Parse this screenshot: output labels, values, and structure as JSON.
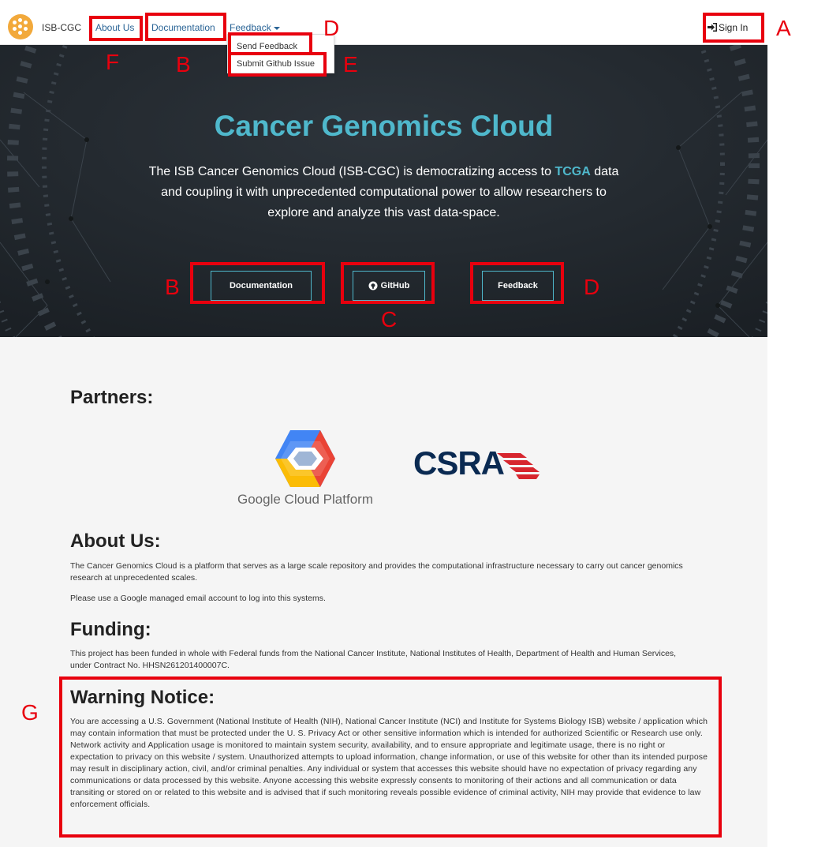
{
  "navbar": {
    "brand": "ISB-CGC",
    "links": [
      "About Us",
      "Documentation",
      "Feedback"
    ],
    "sign_in": "Sign In",
    "dropdown": [
      "Send Feedback",
      "Submit Github Issue"
    ]
  },
  "hero": {
    "title": "Cancer Genomics Cloud",
    "desc_before": "The ISB Cancer Genomics Cloud (ISB-CGC) is democratizing access to",
    "desc_highlight": "TCGA",
    "desc_after": "data and coupling it with unprecedented computational power to allow researchers to explore and analyze this vast data-space.",
    "buttons": [
      "Documentation",
      "GitHub",
      "Feedback"
    ]
  },
  "partners": {
    "heading": "Partners:",
    "google_label": "Google Cloud Platform",
    "csra_label": "CSRA"
  },
  "about": {
    "heading": "About Us:",
    "p1": "The Cancer Genomics Cloud is a platform that serves as a large scale repository and provides the computational infrastructure necessary to carry out cancer genomics research at unprecedented scales.",
    "p2": "Please use a Google managed email account to log into this systems."
  },
  "funding": {
    "heading": "Funding:",
    "p1": "This project has been funded in whole with Federal funds from the National Cancer Institute, National Institutes of Health, Department of Health and Human Services, under Contract No. HHSN261201400007C."
  },
  "warning": {
    "heading": "Warning Notice:",
    "p1": "You are accessing a U.S. Government (National Institute of Health (NIH), National Cancer Institute (NCI) and Institute for Systems Biology ISB) website / application which may contain information that must be protected under the U. S. Privacy Act or other sensitive information which is intended for authorized Scientific or Research use only. Network activity and Application usage is monitored to maintain system security, availability, and to ensure appropriate and legitimate usage, there is no right or expectation to privacy on this website / system. Unauthorized attempts to upload information, change information, or use of this website for other than its intended purpose may result in disciplinary action, civil, and/or criminal penalties. Any individual or system that accesses this website should have no expectation of privacy regarding any communications or data processed by this website. Anyone accessing this website expressly consents to monitoring of their actions and all communication or data transiting or stored on or related to this website and is advised that if such monitoring reveals possible evidence of criminal activity, NIH may provide that evidence to law enforcement officials."
  },
  "annotations": {
    "A": "A",
    "B": "B",
    "C": "C",
    "D": "D",
    "E": "E",
    "F": "F",
    "G": "G",
    "color": "#e8000e"
  },
  "colors": {
    "accent": "#4fb8cc",
    "hero_bg": "#23292f",
    "link": "#2a6496",
    "logo": "#f2a93b",
    "csra_navy": "#0a2a52",
    "csra_red": "#d7262e"
  }
}
